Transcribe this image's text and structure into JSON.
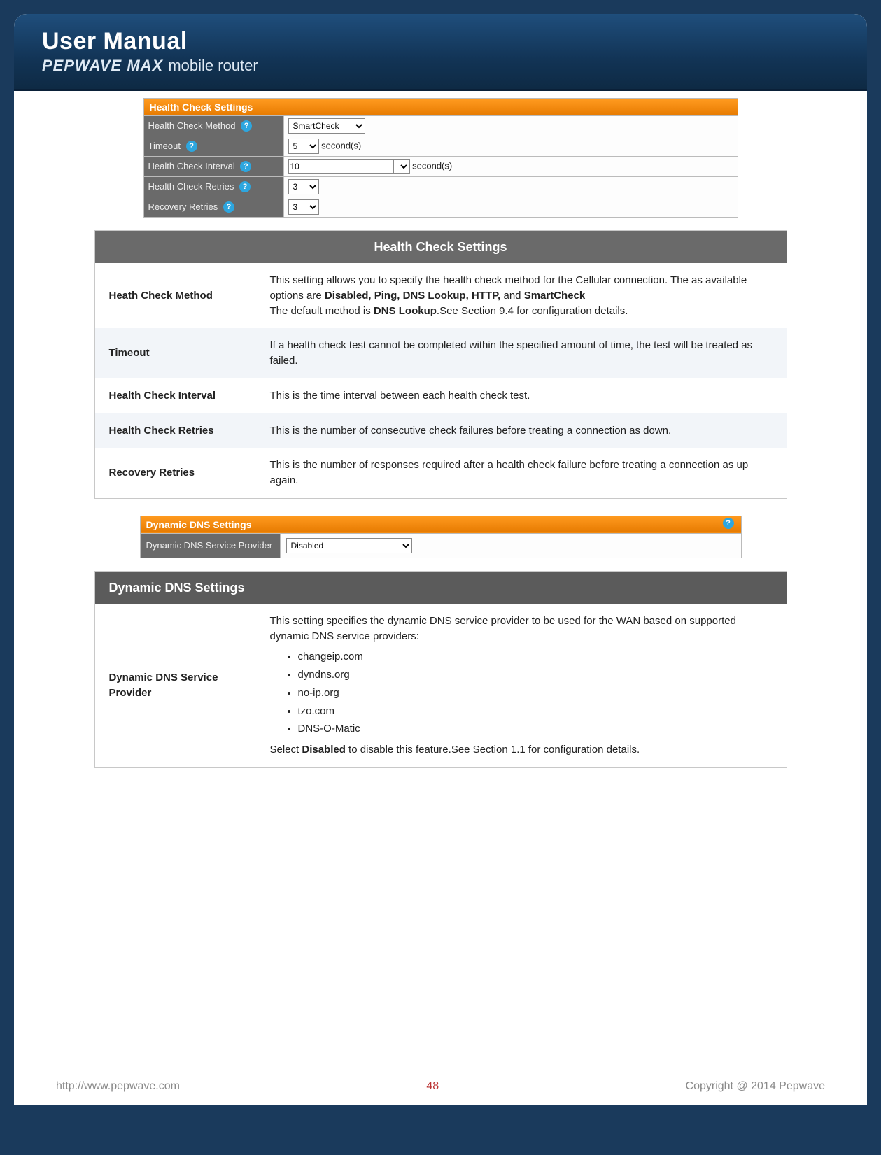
{
  "header": {
    "title1": "User Manual",
    "brand": "PEPWAVE",
    "max": "MAX",
    "sub": " mobile router"
  },
  "ui_health": {
    "title": "Health Check Settings",
    "rows": [
      {
        "label": "Health Check Method",
        "select_value": "SmartCheck",
        "suffix": ""
      },
      {
        "label": "Timeout",
        "select_value": "5",
        "suffix": "second(s)"
      },
      {
        "label": "Health Check Interval",
        "input_value": "10",
        "suffix": "second(s)"
      },
      {
        "label": "Health Check Retries",
        "select_value": "3",
        "suffix": ""
      },
      {
        "label": "Recovery Retries",
        "select_value": "3",
        "suffix": ""
      }
    ]
  },
  "doc_health": {
    "title": "Health Check Settings",
    "rows": [
      {
        "key": "Heath Check Method",
        "desc_pre": "This setting allows you to specify the health check method for the Cellular connection. The as available options are ",
        "desc_bold": "Disabled, Ping, DNS Lookup, HTTP,",
        "desc_mid": " and ",
        "desc_bold2": "SmartCheck",
        "desc_line2a": "The default method is ",
        "desc_line2b": "DNS Lookup",
        "desc_line2c": ".See Section 9.4 for configuration details."
      },
      {
        "key": "Timeout",
        "desc": "If a health check test cannot be completed within the specified amount of time, the test will be treated as failed."
      },
      {
        "key": "Health Check Interval",
        "desc": "This is the time interval between each health check test."
      },
      {
        "key": "Health Check Retries",
        "desc": "This is the number of consecutive check failures before treating a connection as down."
      },
      {
        "key": "Recovery Retries",
        "desc": "This is the number of responses required after a health check failure before treating a connection as up again."
      }
    ]
  },
  "ui_dns": {
    "title": "Dynamic DNS Settings",
    "label": "Dynamic DNS Service Provider",
    "value": "Disabled"
  },
  "doc_dns": {
    "title": "Dynamic DNS Settings",
    "key": "Dynamic DNS Service Provider",
    "intro": "This setting specifies the dynamic DNS service provider to be used for the WAN based on supported dynamic DNS service providers:",
    "providers": [
      "changeip.com",
      "dyndns.org",
      "no-ip.org",
      "tzo.com",
      "DNS-O-Matic"
    ],
    "outro_a": "Select ",
    "outro_b": "Disabled",
    "outro_c": " to disable this feature.See Section 1.1 for configuration details."
  },
  "footer": {
    "url": "http://www.pepwave.com",
    "page": "48",
    "copyright": "Copyright @ 2014 Pepwave"
  }
}
